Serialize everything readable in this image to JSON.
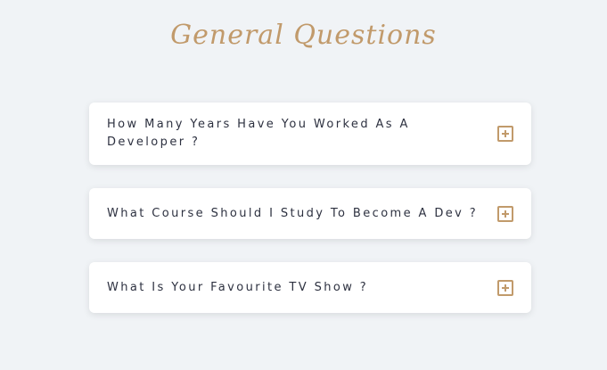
{
  "page": {
    "title": "General Questions"
  },
  "faq": {
    "items": [
      {
        "question": "How Many Years Have You Worked As A Developer ?",
        "icon": "plus-square-icon",
        "expanded": false
      },
      {
        "question": "What Course Should I Study To Become A Dev ?",
        "icon": "plus-square-icon",
        "expanded": false
      },
      {
        "question": "What Is Your Favourite TV Show ?",
        "icon": "plus-square-icon",
        "expanded": false
      }
    ]
  },
  "colors": {
    "background": "#f0f3f6",
    "accent": "#c19a6b",
    "card": "#ffffff",
    "text": "#2d3140"
  }
}
